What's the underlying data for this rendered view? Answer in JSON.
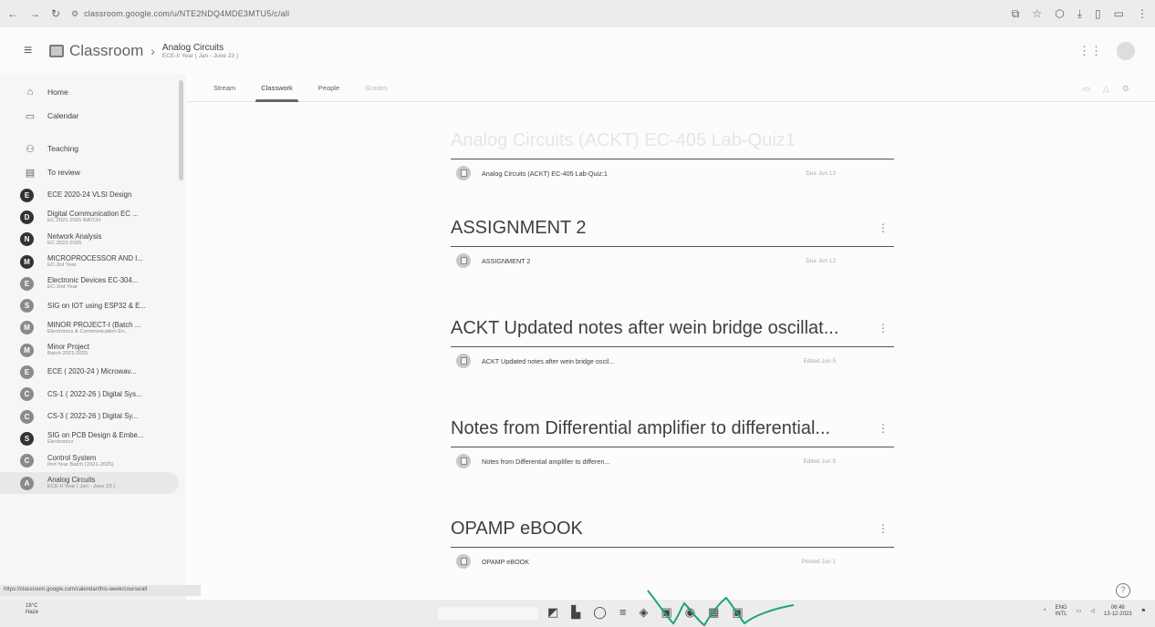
{
  "browser": {
    "url": "classroom.google.com/u/NTE2NDQ4MDE3MTU5/c/all"
  },
  "app": {
    "brand": "Classroom",
    "course_title": "Analog Circuits",
    "course_subtitle": "ECE-II Year ( Jan - June 23 )"
  },
  "sidebar": {
    "home": "Home",
    "calendar": "Calendar",
    "teaching": "Teaching",
    "to_review": "To review",
    "courses": [
      {
        "letter": "E",
        "name": "ECE 2020-24 VLSI Design",
        "sub": "",
        "dark": true
      },
      {
        "letter": "D",
        "name": "Digital Communication EC ...",
        "sub": "EC 2021-2025 BATCH",
        "dark": true
      },
      {
        "letter": "N",
        "name": "Network Analysis",
        "sub": "EC 2022-2026",
        "dark": true
      },
      {
        "letter": "M",
        "name": "MICROPROCESSOR AND I...",
        "sub": "EC-3rd Year",
        "dark": true
      },
      {
        "letter": "E",
        "name": "Electronic Devices EC-304...",
        "sub": "EC-2nd Year",
        "dark": false
      },
      {
        "letter": "S",
        "name": "SIG on IOT using ESP32 & E...",
        "sub": "",
        "dark": false
      },
      {
        "letter": "M",
        "name": "MINOR PROJECT-I (Batch ...",
        "sub": "Electronics & Communication En...",
        "dark": false
      },
      {
        "letter": "M",
        "name": "Minor Project",
        "sub": "Batch 2021-2025",
        "dark": false
      },
      {
        "letter": "E",
        "name": "ECE ( 2020-24 ) Microwav...",
        "sub": "",
        "dark": false
      },
      {
        "letter": "C",
        "name": "CS-1 ( 2022-26 ) Digital Sys...",
        "sub": "",
        "dark": false
      },
      {
        "letter": "C",
        "name": "CS-3 ( 2022-26 ) Digital Sy...",
        "sub": "",
        "dark": false
      },
      {
        "letter": "S",
        "name": "SIG on PCB Design & Embe...",
        "sub": "Electronics",
        "dark": true
      },
      {
        "letter": "C",
        "name": "Control System",
        "sub": "IInd Year Batch (2021-2025)",
        "dark": false
      },
      {
        "letter": "A",
        "name": "Analog Circuits",
        "sub": "ECE-II Year ( Jan - June 23 )",
        "dark": false
      }
    ]
  },
  "status_url": "https://classroom.google.com/calendar/this-week/course/all",
  "tabs": {
    "stream": "Stream",
    "classwork": "Classwork",
    "people": "People",
    "grades": "Grades"
  },
  "topics": [
    {
      "title": "Analog Circuits (ACKT) EC-405 Lab-Quiz1",
      "faint": true,
      "item": "Analog Circuits (ACKT) EC-405 Lab-Quiz:1",
      "date": "Due Jun 13",
      "show_more": false
    },
    {
      "title": "ASSIGNMENT 2",
      "faint": false,
      "item": "ASSIGNMENT 2",
      "date": "Due Jun 12",
      "show_more": true
    },
    {
      "title": "ACKT Updated notes after wein bridge oscillat...",
      "faint": false,
      "item": "ACKT Updated notes after wein bridge oscil...",
      "date": "Edited Jun 5",
      "show_more": true
    },
    {
      "title": "Notes from Differential amplifier to differential...",
      "faint": false,
      "item": "Notes from Differential amplifier to differen...",
      "date": "Edited Jun 5",
      "show_more": true
    },
    {
      "title": "OPAMP eBOOK",
      "faint": false,
      "item": "OPAMP eBOOK",
      "date": "Posted Jun 1",
      "show_more": true
    }
  ],
  "taskbar": {
    "weather_temp": "18°C",
    "weather_desc": "Haze",
    "lang_top": "ENG",
    "lang_bottom": "INTL",
    "time": "06:48",
    "date": "13-12-2023"
  },
  "icons": [
    "menu-icon",
    "classroom-logo-icon",
    "home-icon",
    "calendar-icon",
    "teaching-icon",
    "to-review-icon",
    "help-icon"
  ]
}
